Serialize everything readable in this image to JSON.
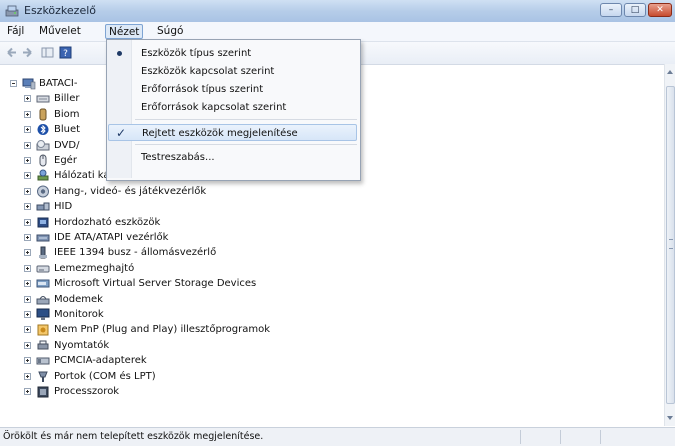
{
  "window": {
    "title": "Eszközkezelő"
  },
  "menu": {
    "items": [
      "Fájl",
      "Művelet",
      "Nézet",
      "Súgó"
    ]
  },
  "tree": {
    "root": "BATACI-",
    "items": [
      {
        "label": "Biller",
        "icon": "keyboard-icon"
      },
      {
        "label": "Biom",
        "icon": "fingerprint-icon"
      },
      {
        "label": "Bluet",
        "icon": "bluetooth-icon"
      },
      {
        "label": "DVD/",
        "icon": "dvd-drive-icon"
      },
      {
        "label": "Egér",
        "icon": "mouse-icon"
      },
      {
        "label": "Hálózati kártyák",
        "icon": "network-adapter-icon"
      },
      {
        "label": "Hang-, videó- és játékvezérlők",
        "icon": "speaker-icon"
      },
      {
        "label": "HID",
        "icon": "hid-icon"
      },
      {
        "label": "Hordozható eszközök",
        "icon": "portable-device-icon"
      },
      {
        "label": "IDE ATA/ATAPI vezérlők",
        "icon": "ide-controller-icon"
      },
      {
        "label": "IEEE 1394 busz - állomásvezérlő",
        "icon": "firewire-icon"
      },
      {
        "label": "Lemezmeghajtó",
        "icon": "disk-drive-icon"
      },
      {
        "label": "Microsoft Virtual Server Storage Devices",
        "icon": "storage-controller-icon"
      },
      {
        "label": "Modemek",
        "icon": "modem-icon"
      },
      {
        "label": "Monitorok",
        "icon": "monitor-icon"
      },
      {
        "label": "Nem PnP (Plug and Play) illesztőprogramok",
        "icon": "driver-icon"
      },
      {
        "label": "Nyomtatók",
        "icon": "printer-icon"
      },
      {
        "label": "PCMCIA-adapterek",
        "icon": "pcmcia-icon"
      },
      {
        "label": "Portok (COM és LPT)",
        "icon": "port-icon"
      },
      {
        "label": "Processzorok",
        "icon": "processor-icon"
      }
    ]
  },
  "view_menu": {
    "items": [
      {
        "label": "Eszközök típus szerint",
        "mark": "bullet"
      },
      {
        "label": "Eszközök kapcsolat szerint",
        "mark": ""
      },
      {
        "label": "Erőforrások típus szerint",
        "mark": ""
      },
      {
        "label": "Erőforrások kapcsolat szerint",
        "mark": ""
      },
      {
        "label": "Rejtett eszközök megjelenítése",
        "mark": "check"
      },
      {
        "label": "Testreszabás...",
        "mark": ""
      }
    ]
  },
  "status": {
    "text": "Örökölt és már nem telepített eszközök megjelenítése."
  },
  "colors": {
    "titlebar": "#b6cde9",
    "highlight": "#d7e6f8",
    "close": "#c74b2e"
  }
}
